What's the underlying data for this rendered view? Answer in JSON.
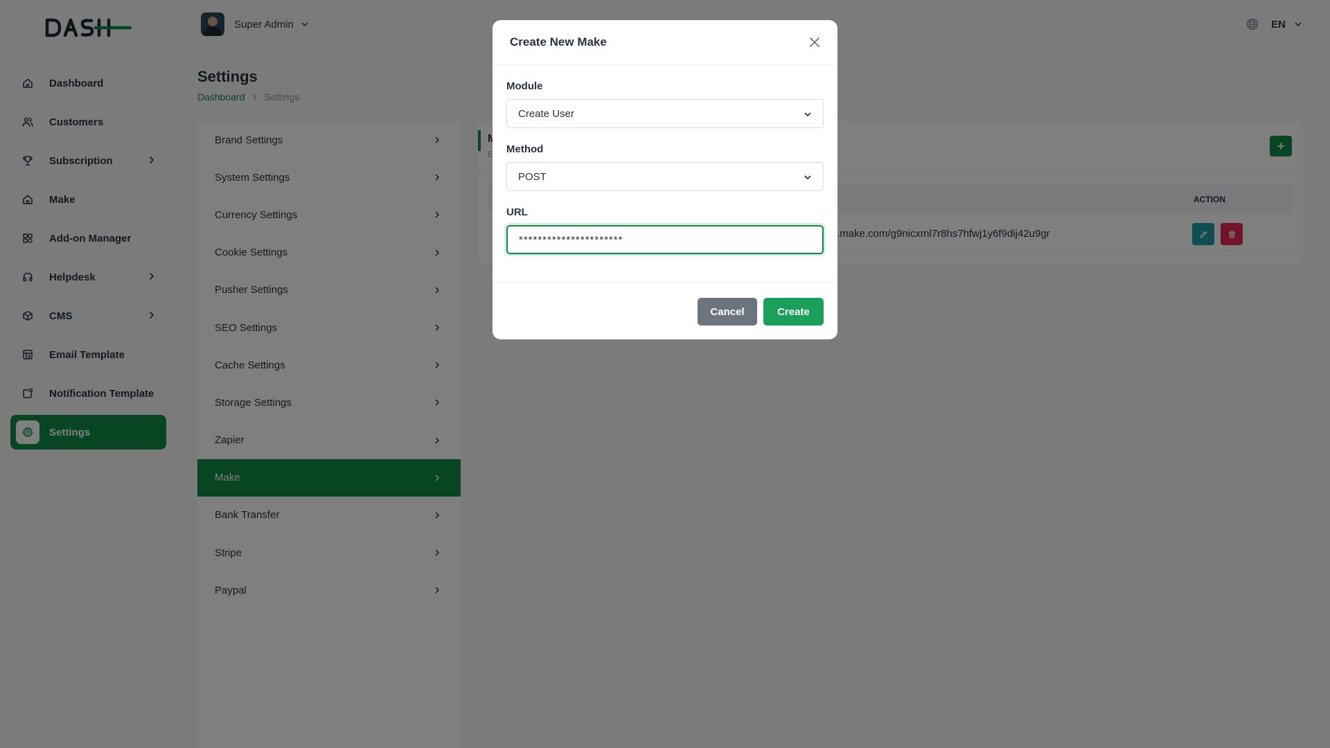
{
  "sidebar": {
    "logo_icon": "dash-logo",
    "items": [
      {
        "label": "Dashboard",
        "icon": "home-icon",
        "has_children": false,
        "active": false
      },
      {
        "label": "Customers",
        "icon": "users-icon",
        "has_children": false,
        "active": false
      },
      {
        "label": "Subscription",
        "icon": "trophy-icon",
        "has_children": true,
        "active": false
      },
      {
        "label": "Make",
        "icon": "home-icon",
        "has_children": false,
        "active": false
      },
      {
        "label": "Add-on Manager",
        "icon": "apps-icon",
        "has_children": false,
        "active": false
      },
      {
        "label": "Helpdesk",
        "icon": "headphones-icon",
        "has_children": true,
        "active": false
      },
      {
        "label": "CMS",
        "icon": "box-icon",
        "has_children": true,
        "active": false
      },
      {
        "label": "Email Template",
        "icon": "template-icon",
        "has_children": false,
        "active": false
      },
      {
        "label": "Notification Template",
        "icon": "notification-icon",
        "has_children": false,
        "active": false
      },
      {
        "label": "Settings",
        "icon": "gear-icon",
        "has_children": false,
        "active": true
      }
    ]
  },
  "header": {
    "user_name": "Super Admin",
    "language": "EN"
  },
  "page": {
    "title": "Settings",
    "breadcrumb": {
      "link": "Dashboard",
      "current": "Settings"
    }
  },
  "settings_menu": [
    {
      "label": "Brand Settings",
      "active": false
    },
    {
      "label": "System Settings",
      "active": false
    },
    {
      "label": "Currency Settings",
      "active": false
    },
    {
      "label": "Cookie Settings",
      "active": false
    },
    {
      "label": "Pusher Settings",
      "active": false
    },
    {
      "label": "SEO Settings",
      "active": false
    },
    {
      "label": "Cache Settings",
      "active": false
    },
    {
      "label": "Storage Settings",
      "active": false
    },
    {
      "label": "Zapier",
      "active": false
    },
    {
      "label": "Make",
      "active": true
    },
    {
      "label": "Bank Transfer",
      "active": false
    },
    {
      "label": "Stripe",
      "active": false
    },
    {
      "label": "Paypal",
      "active": false
    }
  ],
  "content": {
    "card_title": "M",
    "card_subtitle": "E",
    "table": {
      "action_header": "ACTION",
      "rows": [
        {
          "url": ".make.com/g9nicxml7r8hs7hfwj1y6f9dij42u9gr"
        }
      ]
    }
  },
  "modal": {
    "title": "Create New Make",
    "module_label": "Module",
    "module_value": "Create User",
    "method_label": "Method",
    "method_value": "POST",
    "url_label": "URL",
    "url_value": "**********************",
    "cancel_label": "Cancel",
    "create_label": "Create"
  },
  "colors": {
    "primary": "#0f8a46",
    "create_button": "#1aa05a",
    "cancel_button": "#6c757d",
    "edit_button": "#1f9ea8",
    "delete_button": "#e6285a",
    "overlay": "rgba(0,0,0,0.5)"
  }
}
